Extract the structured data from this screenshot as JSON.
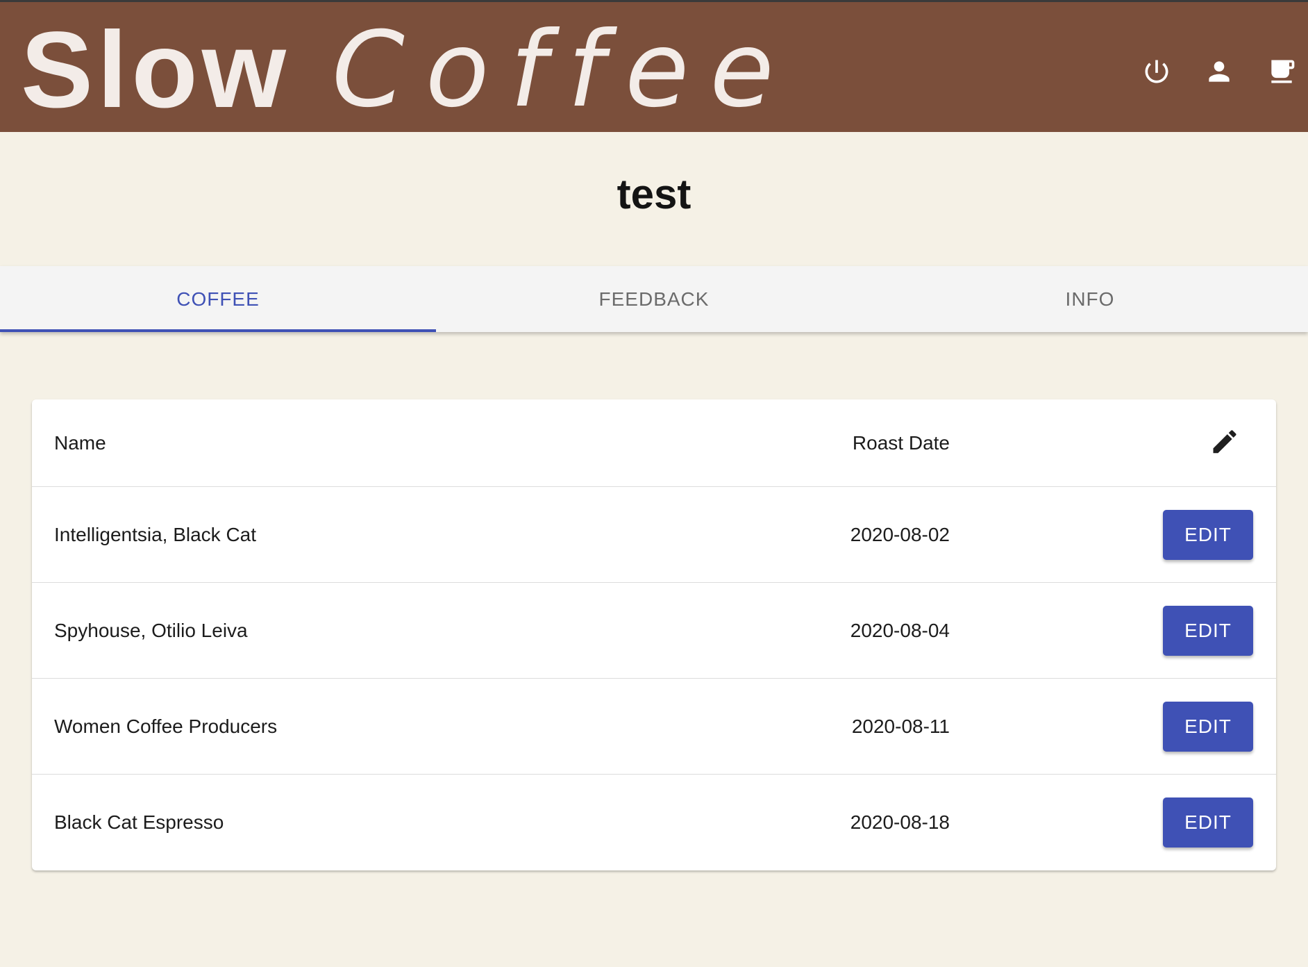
{
  "app": {
    "brand_bold": "Slow",
    "brand_light": "Coffee",
    "colors": {
      "header_bg": "#7B4F3B",
      "page_bg": "#F5F1E6",
      "accent": "#3F51B5"
    },
    "header_icons": [
      "power-icon",
      "person-icon",
      "coffee-cup-icon"
    ]
  },
  "page": {
    "title": "test"
  },
  "tabs": [
    {
      "label": "COFFEE",
      "active": true
    },
    {
      "label": "FEEDBACK",
      "active": false
    },
    {
      "label": "INFO",
      "active": false
    }
  ],
  "table": {
    "columns": {
      "name": "Name",
      "roast_date": "Roast Date",
      "action_icon": "pencil-icon"
    },
    "rows": [
      {
        "name": "Intelligentsia, Black Cat",
        "roast_date": "2020-08-02",
        "action": "EDIT"
      },
      {
        "name": "Spyhouse, Otilio Leiva",
        "roast_date": "2020-08-04",
        "action": "EDIT"
      },
      {
        "name": "Women Coffee Producers",
        "roast_date": "2020-08-11",
        "action": "EDIT"
      },
      {
        "name": "Black Cat Espresso",
        "roast_date": "2020-08-18",
        "action": "EDIT"
      }
    ]
  }
}
